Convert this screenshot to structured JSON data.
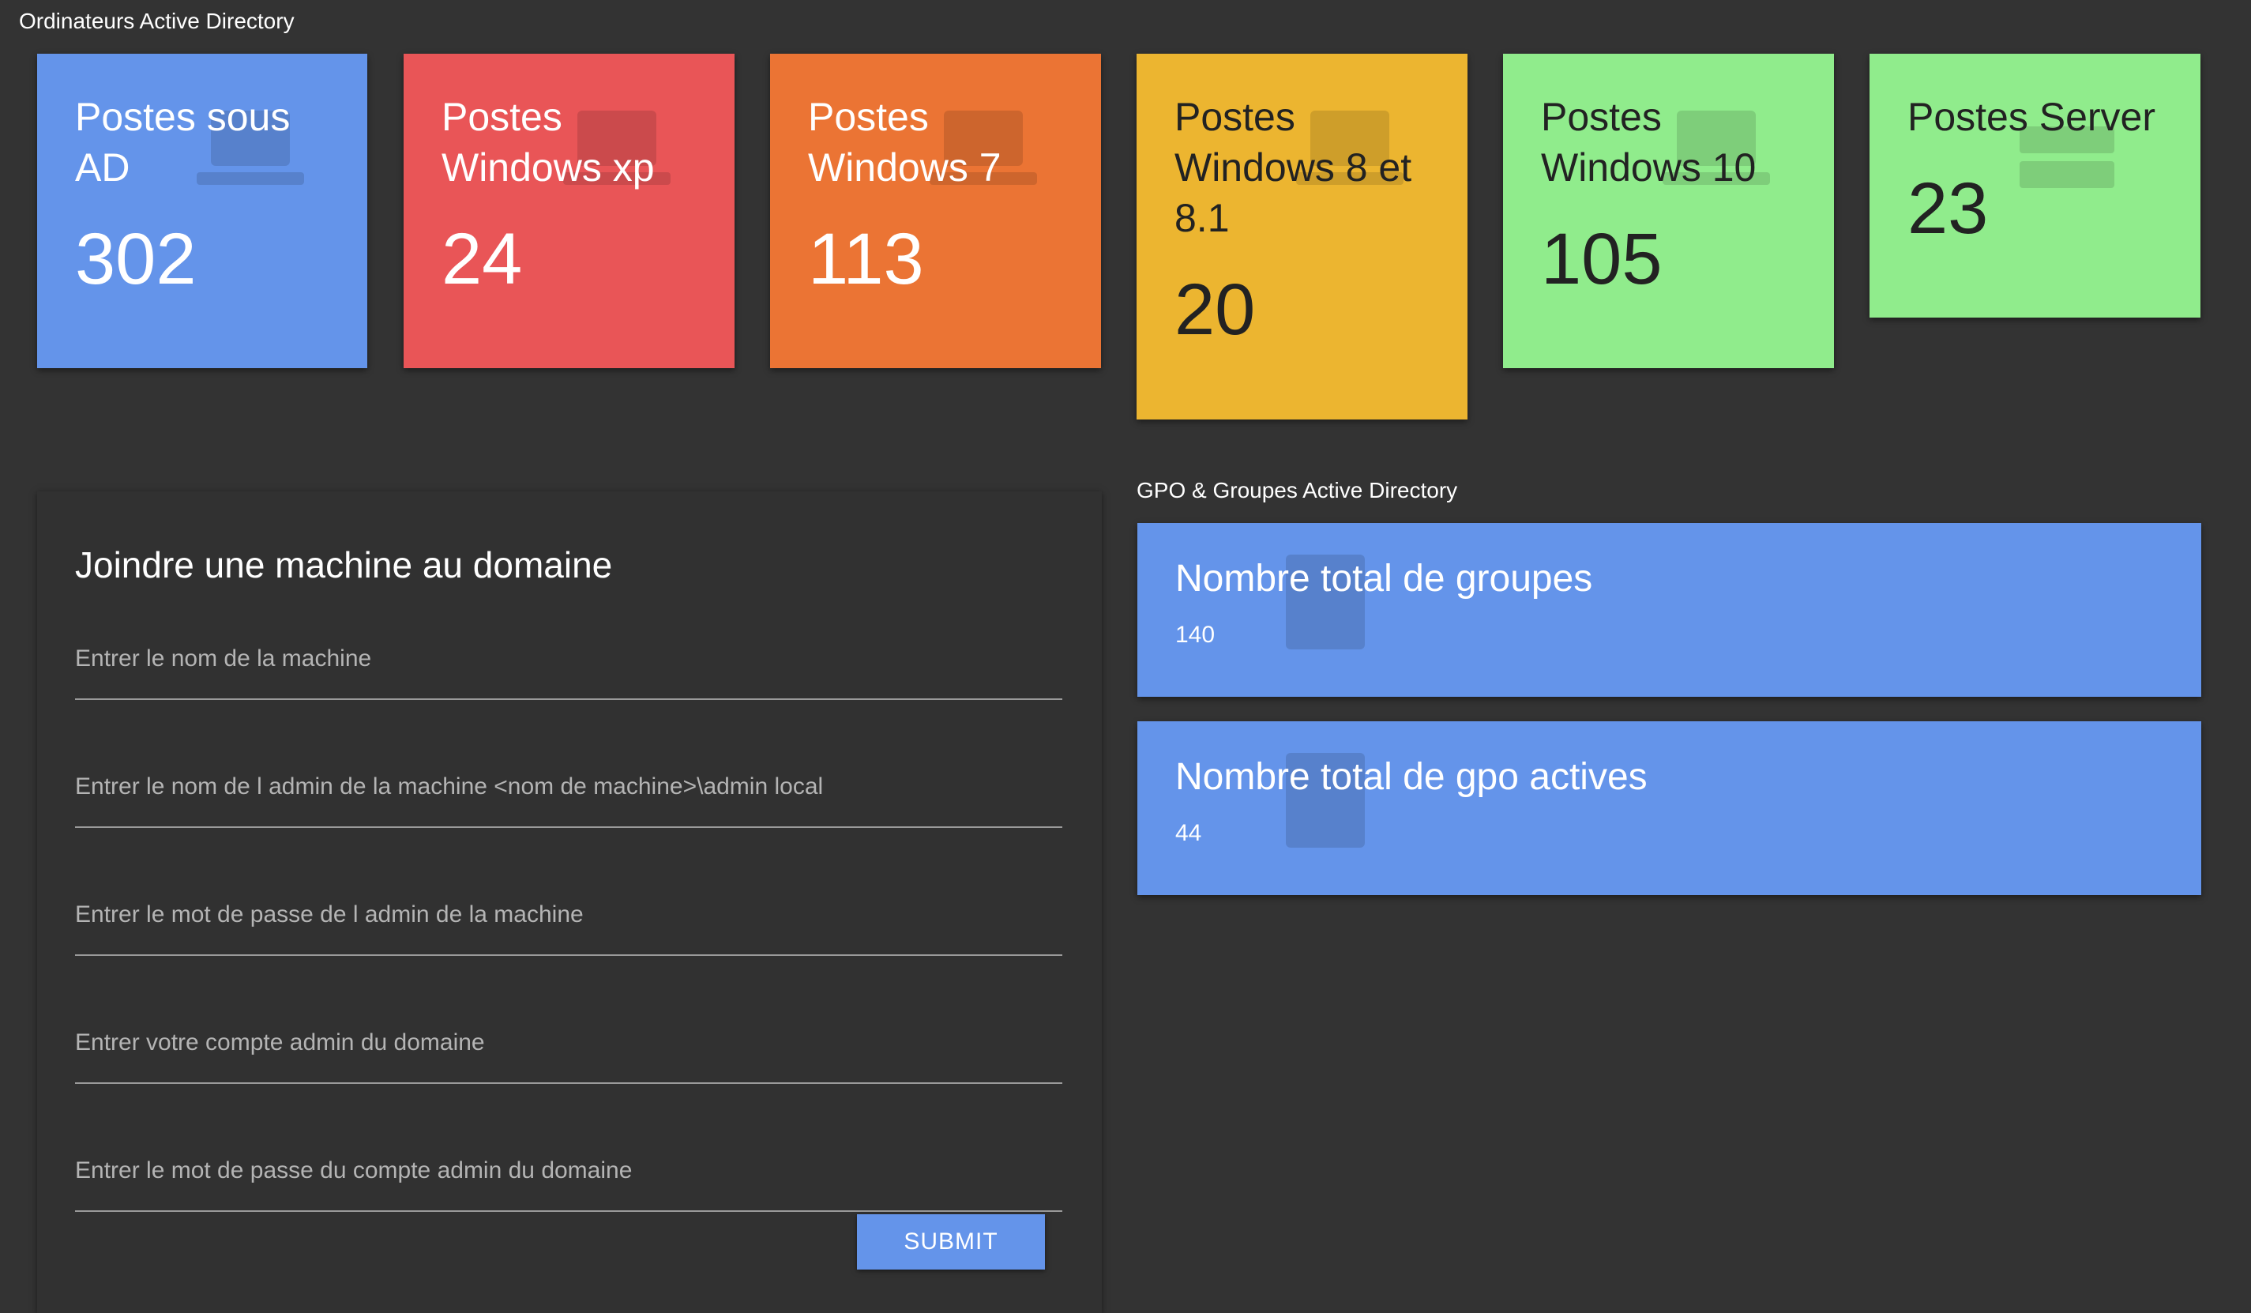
{
  "sections": {
    "computers_title": "Ordinateurs Active Directory",
    "gpo_title": "GPO & Groupes Active Directory"
  },
  "cards": [
    {
      "label": "Postes sous AD",
      "value": "302",
      "color": "#6494ea",
      "icon": "laptop-icon"
    },
    {
      "label": "Postes Windows xp",
      "value": "24",
      "color": "#e95557",
      "icon": "laptop-icon"
    },
    {
      "label": "Postes Windows 7",
      "value": "113",
      "color": "#eb7434",
      "icon": "laptop-icon"
    },
    {
      "label": "Postes Windows 8 et 8.1",
      "value": "20",
      "color": "#ecb530",
      "icon": "laptop-icon"
    },
    {
      "label": "Postes Windows 10",
      "value": "105",
      "color": "#90ec8c",
      "icon": "laptop-icon"
    },
    {
      "label": "Postes Server",
      "value": "23",
      "color": "#90ec8c",
      "icon": "server-icon"
    }
  ],
  "join_form": {
    "title": "Joindre une machine au domaine",
    "fields": [
      {
        "placeholder": "Entrer le nom de la machine",
        "value": ""
      },
      {
        "placeholder": "Entrer le nom de l admin de la machine <nom de machine>\\admin local",
        "value": ""
      },
      {
        "placeholder": "Entrer le mot de passe de l admin de la machine",
        "value": ""
      },
      {
        "placeholder": "Entrer votre compte admin du domaine",
        "value": ""
      },
      {
        "placeholder": "Entrer le mot de passe du compte admin du domaine",
        "value": ""
      }
    ],
    "submit_label": "SUBMIT"
  },
  "gpo_cards": [
    {
      "label": "Nombre total de groupes",
      "value": "140",
      "color": "#6494ea",
      "icon": "group-icon"
    },
    {
      "label": "Nombre total de gpo actives",
      "value": "44",
      "color": "#6494ea",
      "icon": "gpo-icon"
    }
  ]
}
